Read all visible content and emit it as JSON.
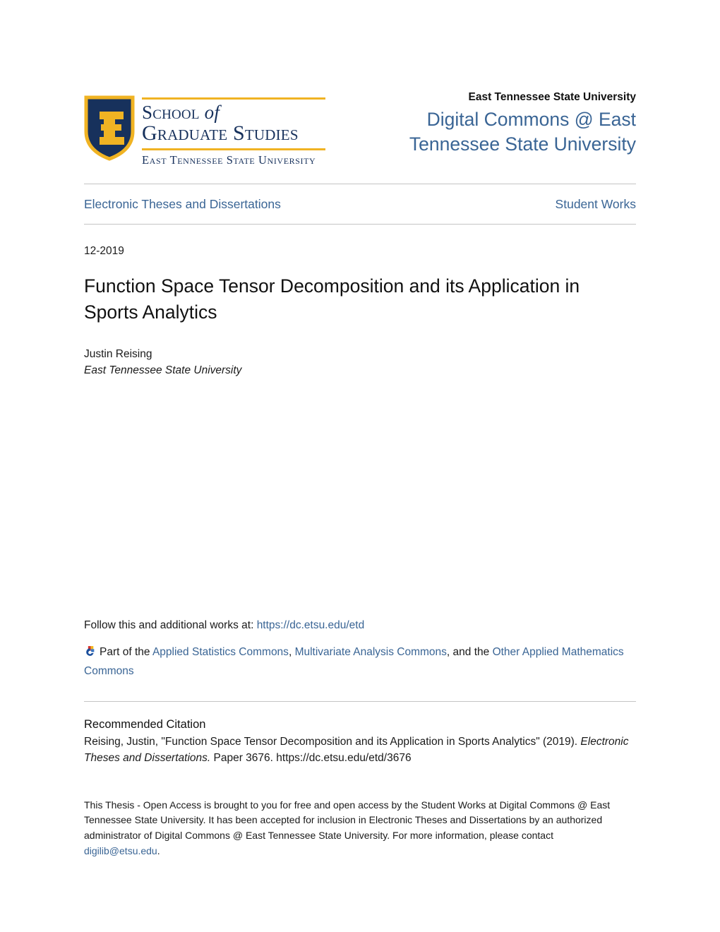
{
  "logo": {
    "shield_alt": "etsu-shield-logo",
    "line1_a": "School",
    "line1_b": "of",
    "line2": "Graduate Studies",
    "subline": "East Tennessee State University",
    "navy": "#17315c",
    "gold": "#f0b323"
  },
  "header": {
    "university": "East Tennessee State University",
    "repository_title": "Digital Commons @ East Tennessee State University",
    "accent_color": "#3a6595"
  },
  "nav": {
    "left_label": "Electronic Theses and Dissertations",
    "right_label": "Student Works"
  },
  "record": {
    "date": "12-2019",
    "title": "Function Space Tensor Decomposition and its Application in Sports Analytics",
    "author_name": "Justin Reising",
    "author_affiliation": "East Tennessee State University"
  },
  "follow": {
    "prefix": "Follow this and additional works at: ",
    "url_text": "https://dc.etsu.edu/etd"
  },
  "commons": {
    "icon_name": "bepress-commons-icon",
    "prefix": "Part of the ",
    "link1": "Applied Statistics Commons",
    "sep1": ", ",
    "link2": "Multivariate Analysis Commons",
    "sep2": ", and the ",
    "link3": "Other Applied Mathematics Commons"
  },
  "citation": {
    "heading": "Recommended Citation",
    "text_before_italic": "Reising, Justin, \"Function Space Tensor Decomposition and its Application in Sports Analytics\" (2019). ",
    "italic_text": "Electronic Theses and Dissertations.",
    "text_after_italic": " Paper 3676. https://dc.etsu.edu/etd/3676"
  },
  "footnote": {
    "text_before_email": "This Thesis - Open Access is brought to you for free and open access by the Student Works at Digital Commons @ East Tennessee State University. It has been accepted for inclusion in Electronic Theses and Dissertations by an authorized administrator of Digital Commons @ East Tennessee State University. For more information, please contact ",
    "email": "digilib@etsu.edu",
    "text_after_email": "."
  }
}
